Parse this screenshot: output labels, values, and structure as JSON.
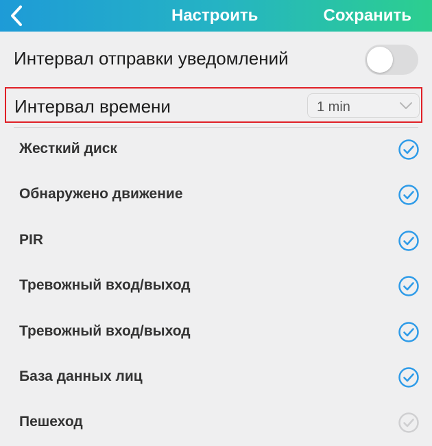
{
  "header": {
    "title": "Настроить",
    "save_label": "Сохранить"
  },
  "notification_interval": {
    "label": "Интервал отправки уведомлений",
    "enabled": false
  },
  "time_interval": {
    "label": "Интервал времени",
    "value": "1 min"
  },
  "items": [
    {
      "label": "Жесткий диск",
      "checked": true
    },
    {
      "label": "Обнаружено движение",
      "checked": true
    },
    {
      "label": "PIR",
      "checked": true
    },
    {
      "label": "Тревожный вход/выход",
      "checked": true
    },
    {
      "label": "Тревожный вход/выход",
      "checked": true
    },
    {
      "label": "База данных лиц",
      "checked": true
    },
    {
      "label": "Пешеход",
      "checked": false
    }
  ],
  "colors": {
    "accent": "#2e9be8",
    "accent_disabled": "#cfcfd1",
    "highlight_border": "#e01f26"
  }
}
